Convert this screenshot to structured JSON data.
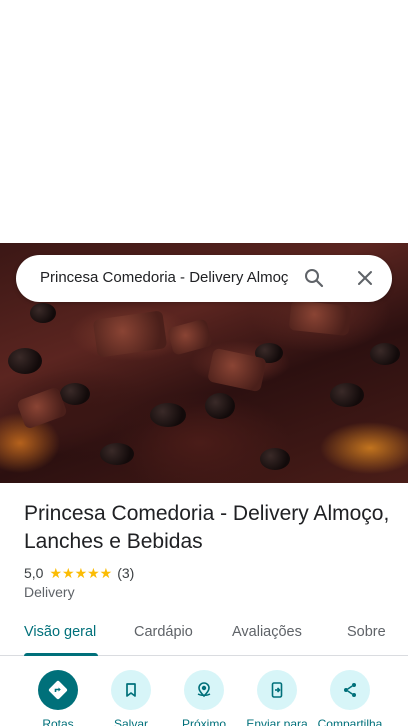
{
  "search": {
    "query": "Princesa Comedoria - Delivery Almoço",
    "search_icon": "search-icon",
    "close_icon": "close-icon"
  },
  "hero": {
    "description_icon": "food-photo"
  },
  "place": {
    "title": "Princesa Comedoria - Delivery Almoço, Lanches e Bebidas",
    "rating": "5,0",
    "stars": "★★★★★",
    "reviews": "(3)",
    "category": "Delivery"
  },
  "tabs": [
    {
      "label": "Visão geral",
      "active": true
    },
    {
      "label": "Cardápio",
      "active": false
    },
    {
      "label": "Avaliações",
      "active": false
    },
    {
      "label": "Sobre",
      "active": false
    }
  ],
  "actions": [
    {
      "label": "Rotas",
      "icon": "directions-icon"
    },
    {
      "label": "Salvar",
      "icon": "bookmark-icon"
    },
    {
      "label": "Próximo",
      "icon": "nearby-icon"
    },
    {
      "label": "Enviar para",
      "icon": "send-to-phone-icon"
    },
    {
      "label": "Compartilha",
      "icon": "share-icon"
    }
  ],
  "colors": {
    "accent": "#00707a",
    "action_bg": "#d7f5f8",
    "star": "#fbbc04"
  }
}
